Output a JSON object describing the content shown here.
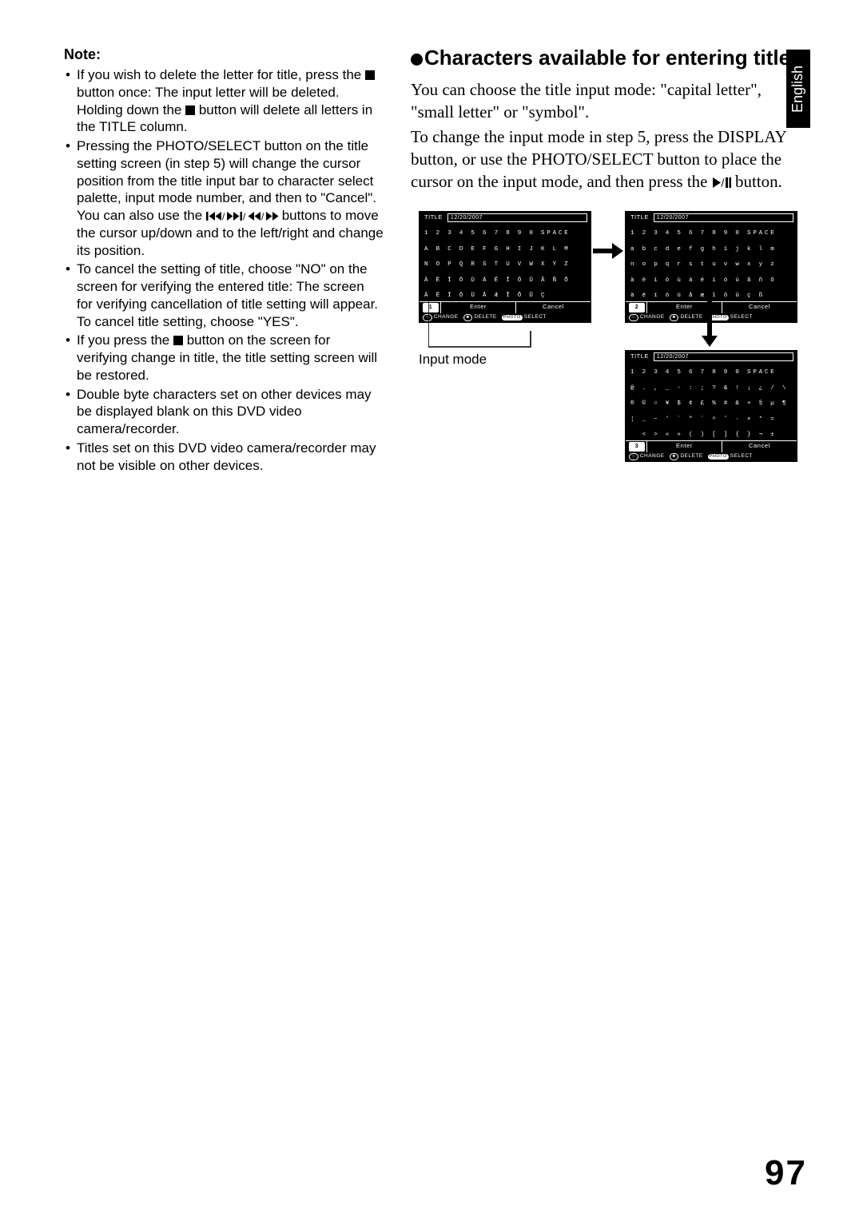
{
  "language_tab": "English",
  "page_number": "97",
  "left": {
    "note_heading": "Note:",
    "bullets": {
      "b1a": "If you wish to delete the letter for title, press the ",
      "b1b": " button once: The input letter will be deleted. Holding down the ",
      "b1c": " button will delete all letters in the TITLE column.",
      "b2a": "Pressing the PHOTO/SELECT button on the title setting screen (in step 5) will change the cursor position from the title input bar to character select palette, input mode number, and then to \"Cancel\". You can also use the ",
      "b2b": " buttons to move the cursor up/down and to the left/right and change its position.",
      "b3": "To cancel the setting of title, choose \"NO\" on the screen for verifying the entered title: The screen for verifying cancellation of title setting will appear. To cancel title setting, choose \"YES\".",
      "b4a": "If you press the ",
      "b4b": " button on the screen for verifying change in title, the title setting screen will be restored.",
      "b5": "Double byte characters set on other devices may be displayed blank on this DVD video camera/recorder.",
      "b6": "Titles set on this DVD video camera/recorder may not be visible on other devices."
    }
  },
  "right": {
    "heading": "Characters available for entering title",
    "p1": "You can choose the title input mode: \"capital letter\", \"small letter\" or \"symbol\".",
    "p2a": "To change the input mode in step 5, press the DISPLAY button, or use the PHOTO/SELECT button to place the cursor on the input mode, and then press the ",
    "p2b": " button.",
    "input_mode_caption": "Input mode"
  },
  "screens": {
    "title_label": "TITLE",
    "title_value": "12/20/2007",
    "enter": "Enter",
    "cancel": "Cancel",
    "legend_change": "CHANGE",
    "legend_delete": "DELETE",
    "legend_photo": "PHOTO",
    "legend_select": "SELECT",
    "cap": {
      "mode": "1",
      "rows": [
        "1 2 3 4 5 6 7 8 9 0 SPACE",
        "A B C D E F G H I J K L M",
        "N O P Q R S T U V W X Y Z",
        "À È Ì Ò Ù Á É Í Ó Ú Â Ñ Õ",
        "Ä Ë Ï Ö Ü Å Æ Î Ô Û Ç"
      ]
    },
    "low": {
      "mode": "2",
      "rows": [
        "1 2 3 4 5 6 7 8 9 0 SPACE",
        "a b c d e f g h i j k l m",
        "n o p q r s t u v w x y z",
        "à è ì ò ù á é í ó ú â ñ õ",
        "ä ë ï ö ü å æ î ô û ç ß"
      ]
    },
    "sym": {
      "mode": "3",
      "rows": [
        "1 2 3 4 5 6 7 8 9 0 SPACE",
        "@ . , _ - : ; ? & ! ¡ ¿ / \\",
        "® © ○ ¥ $ ¢ £ % # & + § µ ¶",
        "¦ _ ~ ' ` \" ´ ^ ˜ · × * =",
        "  < > « » ( ) [ ] { } ¬ ±"
      ]
    }
  }
}
